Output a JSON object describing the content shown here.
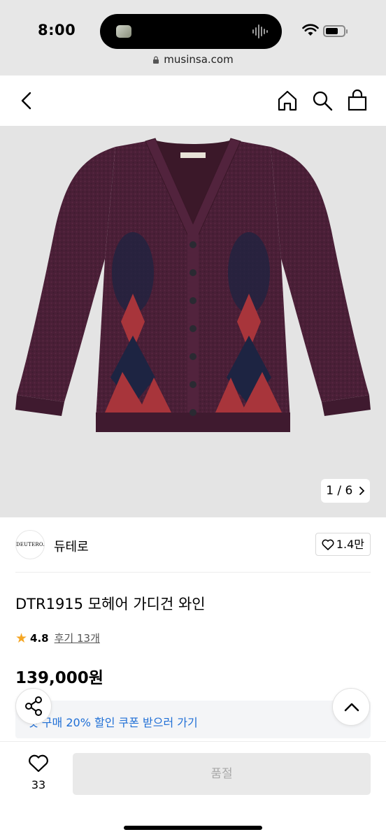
{
  "status_bar": {
    "time": "8:00"
  },
  "browser": {
    "url": "musinsa.com"
  },
  "product": {
    "pager": "1 / 6",
    "brand_logo": "DEUTERO.",
    "brand_name": "듀테로",
    "brand_likes": "1.4만",
    "title": "DTR1915 모헤어 가디건 와인",
    "rating": "4.8",
    "reviews": "후기 13개",
    "price": "139,000원",
    "coupon": "첫 구매 20% 할인 쿠폰 받으러 가기",
    "likes": "33",
    "buy_label": "품절"
  },
  "colors": {
    "sweater": "#4a1f37",
    "argyle_navy": "#1d2442",
    "argyle_red": "#a8353b",
    "coupon_text": "#1f6fd6",
    "star": "#f5a623"
  },
  "icons": [
    "back-icon",
    "home-icon",
    "search-icon",
    "cart-icon",
    "heart-icon",
    "share-icon",
    "chevron-up-icon",
    "chevron-right-icon",
    "star-icon"
  ]
}
